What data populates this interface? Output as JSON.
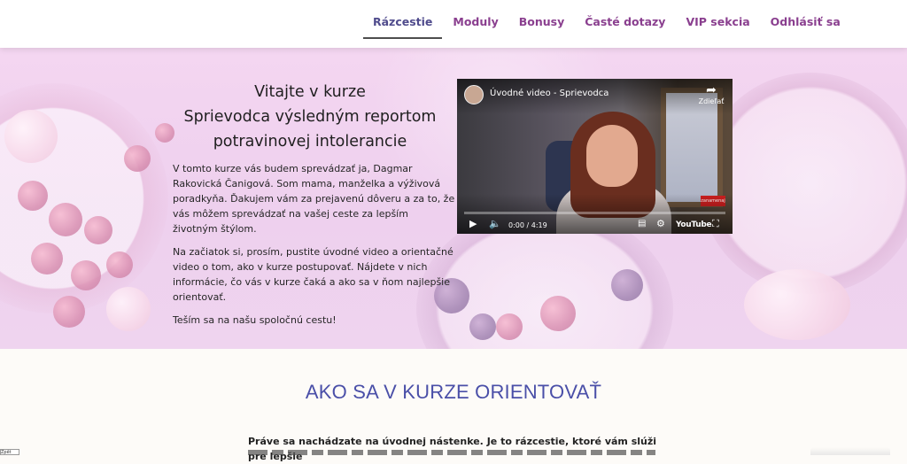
{
  "nav": {
    "items": [
      {
        "label": "Rázcestie",
        "active": true
      },
      {
        "label": "Moduly",
        "active": false
      },
      {
        "label": "Bonusy",
        "active": false
      },
      {
        "label": "Časté dotazy",
        "active": false
      },
      {
        "label": "VIP sekcia",
        "active": false
      },
      {
        "label": "Odhlásiť sa",
        "active": false
      }
    ]
  },
  "hero": {
    "title_lines": [
      "Vitajte v kurze",
      "Sprievodca výsledným reportom",
      "potravinovej intolerancie"
    ],
    "paragraphs": [
      "V tomto kurze vás budem sprevádzať ja, Dagmar Rakovická Čanigová. Som mama, manželka a výživová poradkyňa. Ďakujem vám za prejavenú dôveru a za to, že vás môžem sprevádzať na vašej ceste za lepším životným štýlom.",
      "Na začiatok si, prosím, pustite úvodné video a orientačné video o tom, ako v kurze postupovať. Nájdete v nich informácie, čo vás v kurze čaká a ako sa v ňom najlepšie orientovať.",
      "Teším sa na našu spoločnú cestu!"
    ]
  },
  "video": {
    "title": "Úvodné video - Sprievodca",
    "share_label": "Zdieľať",
    "time": "0:00 / 4:19",
    "youtube_label": "YouTube",
    "badge": "zanamenaj",
    "icons": {
      "share": "share-icon",
      "play": "play-icon",
      "volume": "volume-icon",
      "captions": "captions-icon",
      "settings": "gear-icon",
      "fullscreen": "fullscreen-icon"
    }
  },
  "section": {
    "title": "AKO SA V KURZE ORIENTOVAŤ",
    "intro": "Práve sa nachádzate na úvodnej nástenke. Je to rázcestie, ktoré vám slúži pre lepšie"
  },
  "corner_button": "Zpět"
}
